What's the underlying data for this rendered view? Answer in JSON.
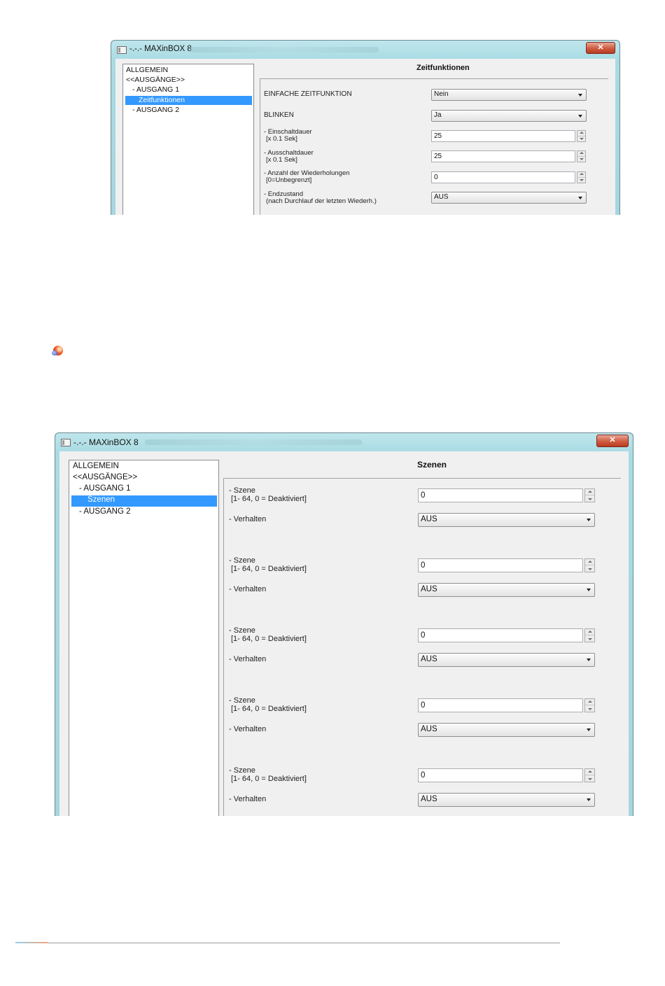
{
  "window1": {
    "title": "-.-.- MAXinBOX 8",
    "close_glyph": "✕",
    "tree": [
      "ALLGEMEIN",
      "<<AUSGÄNGE>>",
      "- AUSGANG 1",
      "Zeitfunktionen",
      "- AUSGANG 2"
    ],
    "section_title": "Zeitfunktionen",
    "fields": {
      "einfache": {
        "label": "EINFACHE ZEITFUNKTION",
        "value": "Nein"
      },
      "blinken": {
        "label": "BLINKEN",
        "value": "Ja"
      },
      "einschalt": {
        "label1": "- Einschaltdauer",
        "label2": "[x 0.1 Sek]",
        "value": "25"
      },
      "ausschalt": {
        "label1": "- Ausschaltdauer",
        "label2": "[x 0.1 Sek]",
        "value": "25"
      },
      "wiederholungen": {
        "label1": "- Anzahl der Wiederholungen",
        "label2": "[0=Unbegrenzt]",
        "value": "0"
      },
      "endzustand": {
        "label1": "- Endzustand",
        "label2": "(nach Durchlauf der letzten Wiederh.)",
        "value": "AUS"
      }
    }
  },
  "window2": {
    "title": "-.-.- MAXinBOX 8",
    "close_glyph": "✕",
    "tree": [
      "ALLGEMEIN",
      "<<AUSGÄNGE>>",
      "- AUSGANG 1",
      "Szenen",
      "- AUSGANG 2"
    ],
    "section_title": "Szenen",
    "scenes": [
      {
        "szene_label1": "- Szene",
        "szene_label2": "[1- 64, 0 = Deaktiviert]",
        "szene_value": "0",
        "verhalten_label": "- Verhalten",
        "verhalten_value": "AUS"
      },
      {
        "szene_label1": "- Szene",
        "szene_label2": "[1- 64, 0 = Deaktiviert]",
        "szene_value": "0",
        "verhalten_label": "- Verhalten",
        "verhalten_value": "AUS"
      },
      {
        "szene_label1": "- Szene",
        "szene_label2": "[1- 64, 0 = Deaktiviert]",
        "szene_value": "0",
        "verhalten_label": "- Verhalten",
        "verhalten_value": "AUS"
      },
      {
        "szene_label1": "- Szene",
        "szene_label2": "[1- 64, 0 = Deaktiviert]",
        "szene_value": "0",
        "verhalten_label": "- Verhalten",
        "verhalten_value": "AUS"
      },
      {
        "szene_label1": "- Szene",
        "szene_label2": "[1- 64, 0 = Deaktiviert]",
        "szene_value": "0",
        "verhalten_label": "- Verhalten",
        "verhalten_value": "AUS"
      }
    ]
  }
}
